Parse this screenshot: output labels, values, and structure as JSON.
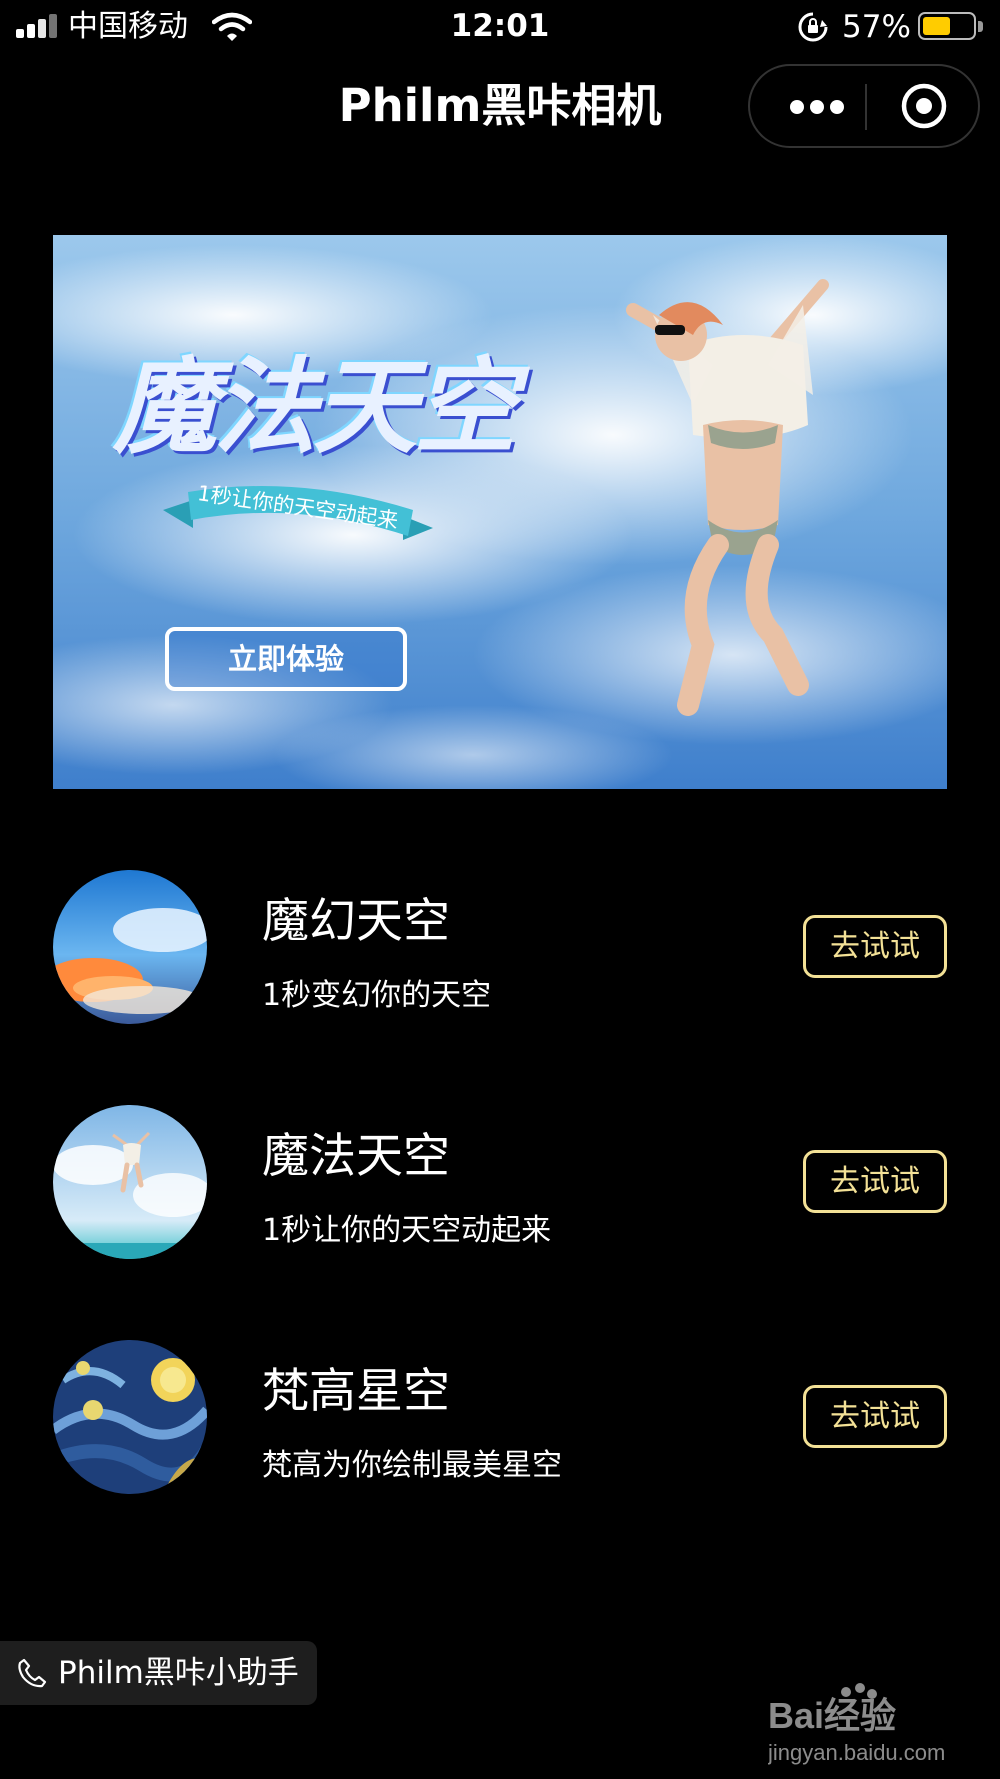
{
  "status_bar": {
    "carrier": "中国移动",
    "time": "12:01",
    "battery_percent": "57%",
    "battery_level": 0.57,
    "battery_color": "#ffcc00"
  },
  "navbar": {
    "title": "Philm黑咔相机",
    "more_icon": "more-dots-icon",
    "close_icon": "target-circle-icon"
  },
  "banner": {
    "title": "魔法天空",
    "subtitle": "1秒让你的天空动起来",
    "cta": "立即体验"
  },
  "features": [
    {
      "name": "魔幻天空",
      "desc": "1秒变幻你的天空",
      "button": "去试试"
    },
    {
      "name": "魔法天空",
      "desc": "1秒让你的天空动起来",
      "button": "去试试"
    },
    {
      "name": "梵高星空",
      "desc": "梵高为你绘制最美星空",
      "button": "去试试"
    }
  ],
  "helper": {
    "label": "Philm黑咔小助手"
  },
  "watermark": {
    "brand": "Bai经验",
    "url": "jingyan.baidu.com"
  },
  "colors": {
    "accent": "#f3e196",
    "background": "#000000"
  }
}
